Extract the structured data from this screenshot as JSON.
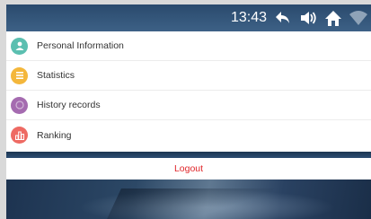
{
  "status_bar": {
    "time": "13:43",
    "icons": [
      "back-icon",
      "volume-icon",
      "home-icon",
      "wifi-icon"
    ]
  },
  "menu": {
    "items": [
      {
        "label": "Personal Information",
        "icon": "person-icon",
        "color": "#5bbfb0"
      },
      {
        "label": "Statistics",
        "icon": "statistics-icon",
        "color": "#f4b73b"
      },
      {
        "label": "History records",
        "icon": "history-icon",
        "color": "#a56bb0"
      },
      {
        "label": "Ranking",
        "icon": "ranking-icon",
        "color": "#ee6a63"
      }
    ]
  },
  "logout": {
    "label": "Logout",
    "color": "#e0262a"
  }
}
